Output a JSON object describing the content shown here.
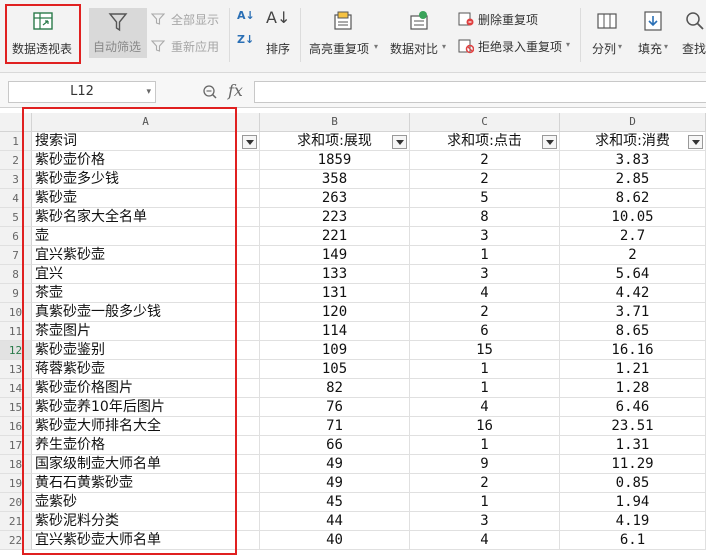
{
  "toolbar": {
    "pivot_table": "数据透视表",
    "auto_filter": "自动筛选",
    "show_all": "全部显示",
    "reapply": "重新应用",
    "sort": "排序",
    "highlight_duplicates": "高亮重复项",
    "data_compare": "数据对比",
    "remove_duplicates": "删除重复项",
    "reject_duplicates": "拒绝录入重复项",
    "split_column": "分列",
    "fill": "填充",
    "find": "查找"
  },
  "formula_bar": {
    "name_box": "L12",
    "fx": "fx"
  },
  "columns": [
    "A",
    "B",
    "C",
    "D"
  ],
  "header_row": [
    "搜索词",
    "求和项:展现",
    "求和项:点击",
    "求和项:消费"
  ],
  "rows": [
    [
      "紫砂壶价格",
      "1859",
      "2",
      "3.83"
    ],
    [
      "紫砂壶多少钱",
      "358",
      "2",
      "2.85"
    ],
    [
      "紫砂壶",
      "263",
      "5",
      "8.62"
    ],
    [
      "紫砂名家大全名单",
      "223",
      "8",
      "10.05"
    ],
    [
      "壶",
      "221",
      "3",
      "2.7"
    ],
    [
      "宜兴紫砂壶",
      "149",
      "1",
      "2"
    ],
    [
      "宜兴",
      "133",
      "3",
      "5.64"
    ],
    [
      "茶壶",
      "131",
      "4",
      "4.42"
    ],
    [
      "真紫砂壶一般多少钱",
      "120",
      "2",
      "3.71"
    ],
    [
      "茶壶图片",
      "114",
      "6",
      "8.65"
    ],
    [
      "紫砂壶鉴别",
      "109",
      "15",
      "16.16"
    ],
    [
      "蒋蓉紫砂壶",
      "105",
      "1",
      "1.21"
    ],
    [
      "紫砂壶价格图片",
      "82",
      "1",
      "1.28"
    ],
    [
      "紫砂壶养10年后图片",
      "76",
      "4",
      "6.46"
    ],
    [
      "紫砂壶大师排名大全",
      "71",
      "16",
      "23.51"
    ],
    [
      "养生壶价格",
      "66",
      "1",
      "1.31"
    ],
    [
      "国家级制壶大师名单",
      "49",
      "9",
      "11.29"
    ],
    [
      "黄石石黄紫砂壶",
      "49",
      "2",
      "0.85"
    ],
    [
      "壶紫砂",
      "45",
      "1",
      "1.94"
    ],
    [
      "紫砂泥料分类",
      "44",
      "3",
      "4.19"
    ],
    [
      "宜兴紫砂壶大师名单",
      "40",
      "4",
      "6.1"
    ]
  ],
  "row_numbers": [
    "1",
    "2",
    "3",
    "4",
    "5",
    "6",
    "7",
    "8",
    "9",
    "10",
    "11",
    "12",
    "13",
    "14",
    "15",
    "16",
    "17",
    "18",
    "19",
    "20",
    "21",
    "22"
  ]
}
